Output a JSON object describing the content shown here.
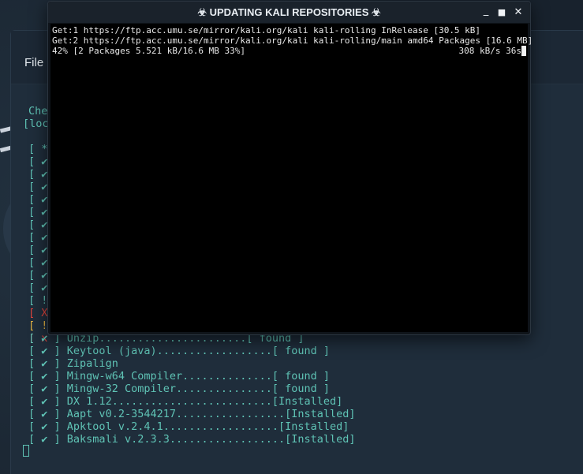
{
  "fg_window": {
    "title": "☣ UPDATING KALI REPOSITORIES ☣",
    "controls": {
      "minimize": "_",
      "maximize": "■",
      "close": "✕"
    },
    "output": [
      "Get:1 https://ftp.acc.umu.se/mirror/kali.org/kali kali-rolling InRelease [30.5 kB]",
      "Get:2 https://ftp.acc.umu.se/mirror/kali.org/kali kali-rolling/main amd64 Packages [16.6 MB]",
      "42% [2 Packages 5.521 kB/16.6 MB 33%]"
    ],
    "speed": "308 kB/s 36s"
  },
  "back_window": {
    "menu_file": "File",
    "check_head": "Che",
    "loc_head": "[loc",
    "partial_rows": [
      {
        "open": "[",
        "mark": "*",
        "kind": "ok"
      },
      {
        "open": "[",
        "mark": "✔",
        "kind": "ok"
      },
      {
        "open": "[",
        "mark": "✔",
        "kind": "ok"
      },
      {
        "open": "[",
        "mark": "✔",
        "kind": "ok"
      },
      {
        "open": "[",
        "mark": "✔",
        "kind": "ok"
      },
      {
        "open": "[",
        "mark": "✔",
        "kind": "ok"
      },
      {
        "open": "[",
        "mark": "✔",
        "kind": "ok"
      },
      {
        "open": "[",
        "mark": "✔",
        "kind": "ok"
      },
      {
        "open": "[",
        "mark": "✔",
        "kind": "ok"
      },
      {
        "open": "[",
        "mark": "✔",
        "kind": "ok"
      },
      {
        "open": "[",
        "mark": "✔",
        "kind": "ok"
      },
      {
        "open": "[",
        "mark": "✔",
        "kind": "ok"
      },
      {
        "open": "[",
        "mark": "!",
        "kind": "ok"
      },
      {
        "open": "[",
        "mark": "X",
        "kind": "err"
      },
      {
        "open": "[",
        "mark": "!",
        "kind": "warn"
      },
      {
        "open": "[",
        "mark": "x",
        "kind": "err"
      }
    ],
    "rows": [
      {
        "mark": "✔",
        "text": "Unzip.......................[ found ]"
      },
      {
        "mark": "✔",
        "text": "Keytool (java)..................[ found ]"
      },
      {
        "mark": "✔",
        "text": "Zipalign"
      },
      {
        "mark": "✔",
        "text": "Mingw-w64 Compiler..............[ found ]"
      },
      {
        "mark": "✔",
        "text": "Mingw-32 Compiler...............[ found ]"
      },
      {
        "mark": "✔",
        "text": "DX 1.12.........................[Installed]"
      },
      {
        "mark": "✔",
        "text": "Aapt v0.2-3544217.................[Installed]"
      },
      {
        "mark": "✔",
        "text": "Apktool v.2.4.1..................[Installed]"
      },
      {
        "mark": "✔",
        "text": "Baksmali v.2.3.3..................[Installed]"
      }
    ]
  },
  "colors": {
    "accent": "#5fc3b5",
    "error": "#e0453d",
    "warning": "#e4b343",
    "terminal_bg": "#000000"
  }
}
